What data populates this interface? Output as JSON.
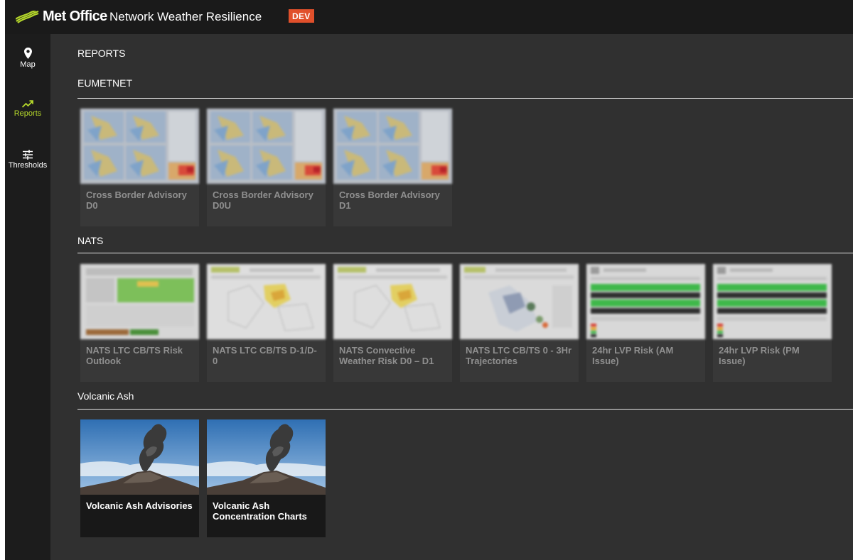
{
  "header": {
    "logo_text": "Met Office",
    "app_title": "Network Weather Resilience",
    "env_badge": "DEV"
  },
  "colors": {
    "accent": "#b6d92b",
    "badge": "#e1502b",
    "header_bg": "#1a1a1a",
    "sidebar_bg": "#1c1c1c",
    "content_bg": "#303030"
  },
  "sidebar": {
    "items": [
      {
        "label": "Map",
        "icon": "map-pin-icon",
        "active": false
      },
      {
        "label": "Reports",
        "icon": "trending-up-icon",
        "active": true
      },
      {
        "label": "Thresholds",
        "icon": "sliders-icon",
        "active": false
      }
    ]
  },
  "page": {
    "title": "REPORTS"
  },
  "sections": [
    {
      "title": "EUMETNET",
      "cards": [
        {
          "label": "Cross Border Advisory D0",
          "thumbnail": "map-grid-thumbnail"
        },
        {
          "label": "Cross Border Advisory D0U",
          "thumbnail": "map-grid-thumbnail"
        },
        {
          "label": "Cross Border Advisory D1",
          "thumbnail": "map-grid-thumbnail"
        }
      ]
    },
    {
      "title": "NATS",
      "cards": [
        {
          "label": "NATS LTC CB/TS Risk Outlook",
          "thumbnail": "table-thumbnail"
        },
        {
          "label": "NATS LTC CB/TS D-1/D-0",
          "thumbnail": "map-doc-thumbnail"
        },
        {
          "label": "NATS Convective Weather Risk D0 – D1",
          "thumbnail": "map-doc-thumbnail"
        },
        {
          "label": "NATS LTC CB/TS 0 - 3Hr Trajectories",
          "thumbnail": "trajectory-thumbnail"
        },
        {
          "label": "24hr LVP Risk (AM Issue)",
          "thumbnail": "risk-band-thumbnail"
        },
        {
          "label": "24hr LVP Risk (PM Issue)",
          "thumbnail": "risk-band-thumbnail"
        }
      ]
    },
    {
      "title": "Volcanic Ash",
      "cards": [
        {
          "label": "Volcanic Ash Advisories",
          "thumbnail": "volcano-photo"
        },
        {
          "label": "Volcanic Ash Concentration Charts",
          "thumbnail": "volcano-photo"
        }
      ]
    }
  ]
}
